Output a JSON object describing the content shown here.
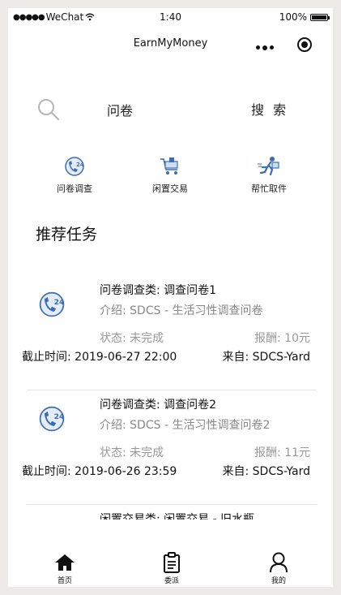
{
  "status_bar": {
    "carrier": "WeChat",
    "time": "1:40",
    "battery": "100%",
    "battery_level": 1.0
  },
  "nav": {
    "title": "EarnMyMoney"
  },
  "search": {
    "value": "问卷",
    "button_label": "搜 索"
  },
  "categories": [
    {
      "label": "问卷调查",
      "icon": "survey-24h-icon"
    },
    {
      "label": "闲置交易",
      "icon": "shopping-cart-icon"
    },
    {
      "label": "帮忙取件",
      "icon": "delivery-runner-icon"
    }
  ],
  "section": {
    "title": "推荐任务"
  },
  "tasks": [
    {
      "title": "问卷调查类: 调查问卷1",
      "intro": "介绍: SDCS - 生活习性调查问卷",
      "status": "状态: 未完成",
      "reward": "报酬: 10元",
      "deadline": "截止时间: 2019-06-27 22:00",
      "from": "来自: SDCS-Yard"
    },
    {
      "title": "问卷调查类: 调查问卷2",
      "intro": "介绍: SDCS - 生活习性调查问卷2",
      "status": "状态: 未完成",
      "reward": "报酬: 11元",
      "deadline": "截止时间: 2019-06-26 23:59",
      "from": "来自: SDCS-Yard"
    },
    {
      "title": "闲置交易类: 闲置交易 - 旧水瓶"
    }
  ],
  "tabbar": [
    {
      "label": "首页",
      "icon": "home-icon"
    },
    {
      "label": "委派",
      "icon": "clipboard-icon"
    },
    {
      "label": "我的",
      "icon": "user-icon"
    }
  ],
  "colors": {
    "accent_blue": "#3b6db3",
    "text_gray": "#888888",
    "background": "#ecebe8"
  }
}
